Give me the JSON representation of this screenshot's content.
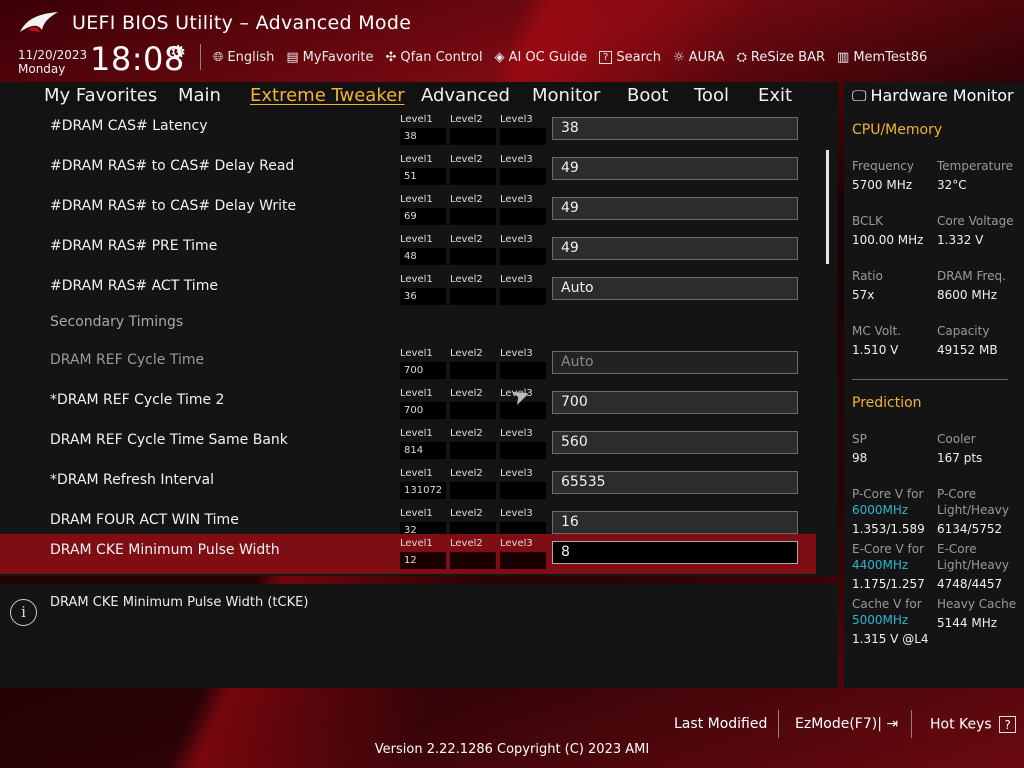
{
  "header": {
    "title": "UEFI BIOS Utility – Advanced Mode",
    "date": "11/20/2023",
    "day": "Monday",
    "time": "18:08",
    "toolbar": [
      {
        "label": "English",
        "icon": "globe-icon"
      },
      {
        "label": "MyFavorite",
        "icon": "favorite-icon"
      },
      {
        "label": "Qfan Control",
        "icon": "fan-icon"
      },
      {
        "label": "AI OC Guide",
        "icon": "ai-oc-icon"
      },
      {
        "label": "Search",
        "icon": "search-icon"
      },
      {
        "label": "AURA",
        "icon": "aura-icon"
      },
      {
        "label": "ReSize BAR",
        "icon": "resize-bar-icon"
      },
      {
        "label": "MemTest86",
        "icon": "memtest-icon"
      }
    ]
  },
  "menu": {
    "tabs": [
      "My Favorites",
      "Main",
      "Extreme Tweaker",
      "Advanced",
      "Monitor",
      "Boot",
      "Tool",
      "Exit"
    ],
    "active": "Extreme Tweaker"
  },
  "level_labels": [
    "Level1",
    "Level2",
    "Level3"
  ],
  "settings": [
    {
      "label": "#DRAM CAS# Latency",
      "level1": "38",
      "value": "38"
    },
    {
      "label": "#DRAM RAS# to CAS# Delay Read",
      "level1": "51",
      "value": "49"
    },
    {
      "label": "#DRAM RAS# to CAS# Delay Write",
      "level1": "69",
      "value": "49"
    },
    {
      "label": "#DRAM RAS# PRE Time",
      "level1": "48",
      "value": "49"
    },
    {
      "label": "#DRAM RAS# ACT Time",
      "level1": "36",
      "value": "Auto"
    },
    {
      "label": "DRAM REF Cycle Time",
      "level1": "700",
      "value": "Auto"
    },
    {
      "label": "*DRAM REF Cycle Time 2",
      "level1": "700",
      "value": "700"
    },
    {
      "label": "DRAM REF Cycle Time Same Bank",
      "level1": "814",
      "value": "560"
    },
    {
      "label": "*DRAM Refresh Interval",
      "level1": "131072",
      "value": "65535"
    },
    {
      "label": "DRAM FOUR ACT WIN Time",
      "level1": "32",
      "value": "16"
    },
    {
      "label": "DRAM CKE Minimum Pulse Width",
      "level1": "12",
      "value": "8"
    }
  ],
  "secondary_header": "Secondary Timings",
  "info": {
    "text": "DRAM CKE Minimum Pulse Width (tCKE)",
    "icon": "info-icon"
  },
  "hwmon": {
    "title": "Hardware Monitor",
    "cpu_section": "CPU/Memory",
    "frequency_label": "Frequency",
    "frequency": "5700 MHz",
    "temperature_label": "Temperature",
    "temperature": "32°C",
    "bclk_label": "BCLK",
    "bclk": "100.00 MHz",
    "core_voltage_label": "Core Voltage",
    "core_voltage": "1.332 V",
    "ratio_label": "Ratio",
    "ratio": "57x",
    "dram_freq_label": "DRAM Freq.",
    "dram_freq": "8600 MHz",
    "mc_volt_label": "MC Volt.",
    "mc_volt": "1.510 V",
    "capacity_label": "Capacity",
    "capacity": "49152 MB",
    "prediction_section": "Prediction",
    "sp_label": "SP",
    "sp": "98",
    "cooler_label": "Cooler",
    "cooler": "167 pts",
    "pcore_v_label": "P-Core V for",
    "pcore_v_freq": "6000MHz",
    "pcore_v": "1.353/1.589",
    "pcore_lh_label1": "P-Core",
    "pcore_lh_label2": "Light/Heavy",
    "pcore_lh": "6134/5752",
    "ecore_v_label": "E-Core V for",
    "ecore_v_freq": "4400MHz",
    "ecore_v": "1.175/1.257",
    "ecore_lh_label1": "E-Core",
    "ecore_lh_label2": "Light/Heavy",
    "ecore_lh": "4748/4457",
    "cache_v_label": "Cache V for",
    "cache_v_freq": "5000MHz",
    "cache_v": "1.315 V @L4",
    "heavy_cache_label": "Heavy Cache",
    "heavy_cache": "5144 MHz"
  },
  "footer": {
    "last_modified": "Last Modified",
    "ezmode": "EzMode(F7)|",
    "hotkeys": "Hot Keys",
    "hotkeys_key": "?",
    "version": "Version 2.22.1286 Copyright (C) 2023 AMI"
  }
}
